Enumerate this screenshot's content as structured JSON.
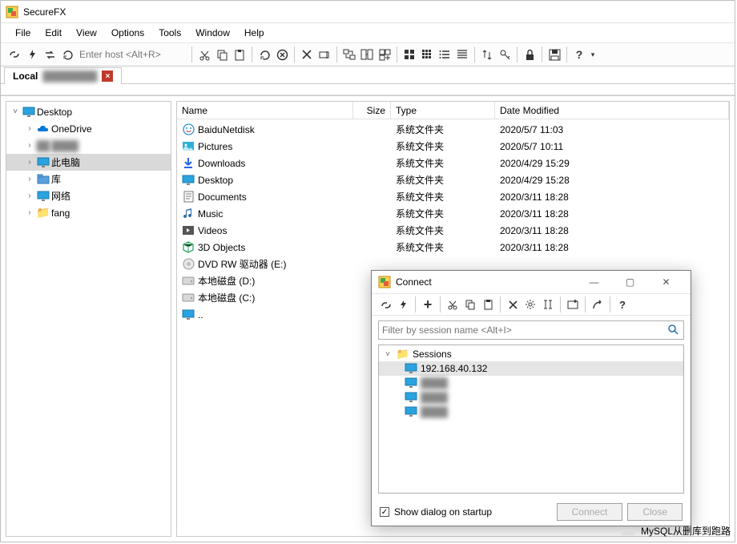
{
  "title": "SecureFX",
  "menu": [
    "File",
    "Edit",
    "View",
    "Options",
    "Tools",
    "Window",
    "Help"
  ],
  "host_placeholder": "Enter host <Alt+R>",
  "tab": {
    "label": "Local",
    "close": "×"
  },
  "tree": [
    {
      "expand": "˅",
      "icon": "monitor",
      "label": "Desktop",
      "lvl": 0
    },
    {
      "expand": "›",
      "icon": "cloud",
      "label": "OneDrive",
      "lvl": 1
    },
    {
      "expand": "›",
      "icon": "blur",
      "label": "",
      "lvl": 1,
      "blur": true
    },
    {
      "expand": "›",
      "icon": "monitor",
      "label": "此电脑",
      "lvl": 1,
      "sel": true
    },
    {
      "expand": "›",
      "icon": "folder-b",
      "label": "库",
      "lvl": 1
    },
    {
      "expand": "›",
      "icon": "monitor",
      "label": "网络",
      "lvl": 1
    },
    {
      "expand": "›",
      "icon": "folder",
      "label": "fang",
      "lvl": 1
    }
  ],
  "columns": {
    "name": "Name",
    "size": "Size",
    "type": "Type",
    "date": "Date Modified"
  },
  "rows": [
    {
      "icon": "baidu",
      "name": "BaiduNetdisk",
      "type": "系统文件夹",
      "date": "2020/5/7 11:03"
    },
    {
      "icon": "pic",
      "name": "Pictures",
      "type": "系统文件夹",
      "date": "2020/5/7 10:11"
    },
    {
      "icon": "dl",
      "name": "Downloads",
      "type": "系统文件夹",
      "date": "2020/4/29 15:29"
    },
    {
      "icon": "monitor",
      "name": "Desktop",
      "type": "系统文件夹",
      "date": "2020/4/29 15:28"
    },
    {
      "icon": "doc",
      "name": "Documents",
      "type": "系统文件夹",
      "date": "2020/3/11 18:28"
    },
    {
      "icon": "mus",
      "name": "Music",
      "type": "系统文件夹",
      "date": "2020/3/11 18:28"
    },
    {
      "icon": "vid",
      "name": "Videos",
      "type": "系统文件夹",
      "date": "2020/3/11 18:28"
    },
    {
      "icon": "3d",
      "name": "3D Objects",
      "type": "系统文件夹",
      "date": "2020/3/11 18:28"
    },
    {
      "icon": "disc",
      "name": "DVD RW 驱动器 (E:)",
      "type": "",
      "date": ""
    },
    {
      "icon": "hdd",
      "name": "本地磁盘 (D:)",
      "type": "",
      "date": ""
    },
    {
      "icon": "hdd",
      "name": "本地磁盘 (C:)",
      "type": "",
      "date": ""
    },
    {
      "icon": "monitor",
      "name": "..",
      "type": "",
      "date": ""
    }
  ],
  "connect": {
    "title": "Connect",
    "filter_placeholder": "Filter by session name <Alt+I>",
    "root": "Sessions",
    "selected": "192.168.40.132",
    "show_label": "Show dialog on startup",
    "btn_connect": "Connect",
    "btn_close": "Close"
  },
  "watermark": "MySQL从删库到跑路"
}
